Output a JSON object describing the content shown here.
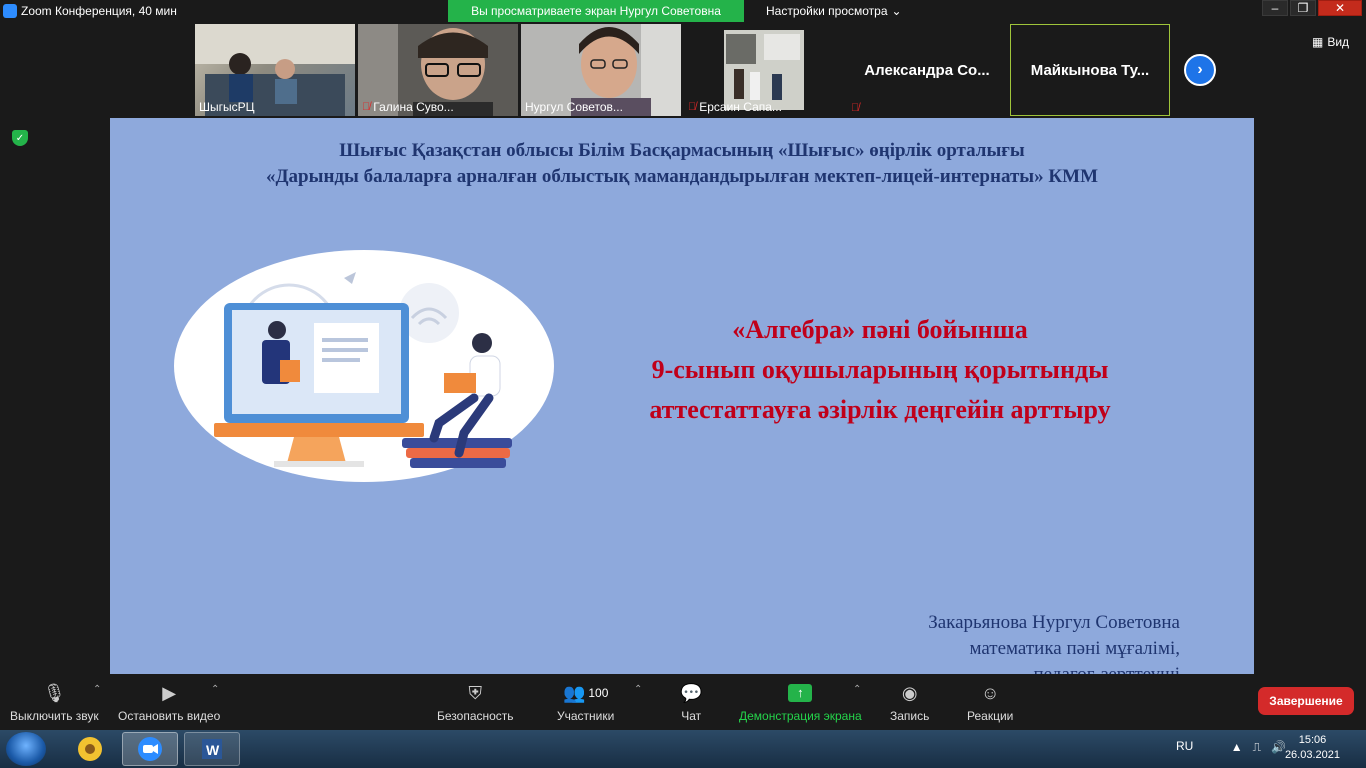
{
  "window": {
    "title": "Zoom Конференция, 40 мин",
    "share_banner": "Вы просматриваете экран Нургул Советовна",
    "view_options": "Настройки просмотра",
    "view_button": "Вид"
  },
  "participants": [
    {
      "name": "ШыгысРЦ",
      "muted": false
    },
    {
      "name": "Галина Суво...",
      "muted": true
    },
    {
      "name": "Нургул Советов...",
      "muted": false
    },
    {
      "name": "Ерсаин Сапа...",
      "muted": true
    },
    {
      "name": "Александра  Со...",
      "muted": true
    },
    {
      "name": "Майкынова  Ту...",
      "muted": false
    }
  ],
  "slide": {
    "org_line1": "Шығыс Қазақстан облысы Білім Басқармасының «Шығыс» өңірлік орталығы",
    "org_line2": "«Дарынды балаларға арналған облыстық мамандандырылған  мектеп-лицей-интернаты» КММ",
    "title_line1": "«Алгебра» пәні бойынша",
    "title_line2": "9-сынып оқушыларының қорытынды",
    "title_line3": "аттестаттауға әзірлік деңгейін арттыру",
    "author_name": "Закарьянова Нургул Советовна",
    "author_role": "математика пәні мұғалімі,",
    "author_role2": "педагог-зерттеуші"
  },
  "toolbar": {
    "mute": "Выключить звук",
    "video": "Остановить видео",
    "security": "Безопасность",
    "participants": "Участники",
    "participants_count": "100",
    "chat": "Чат",
    "share": "Демонстрация экрана",
    "record": "Запись",
    "reactions": "Реакции",
    "end": "Завершение"
  },
  "taskbar": {
    "lang": "RU",
    "time": "15:06",
    "date": "26.03.2021"
  },
  "colors": {
    "share_green": "#24b34a",
    "end_red": "#d42a2a",
    "slide_bg": "#8ea9dc",
    "slide_title": "#c0001a",
    "slide_org": "#1f3570"
  }
}
